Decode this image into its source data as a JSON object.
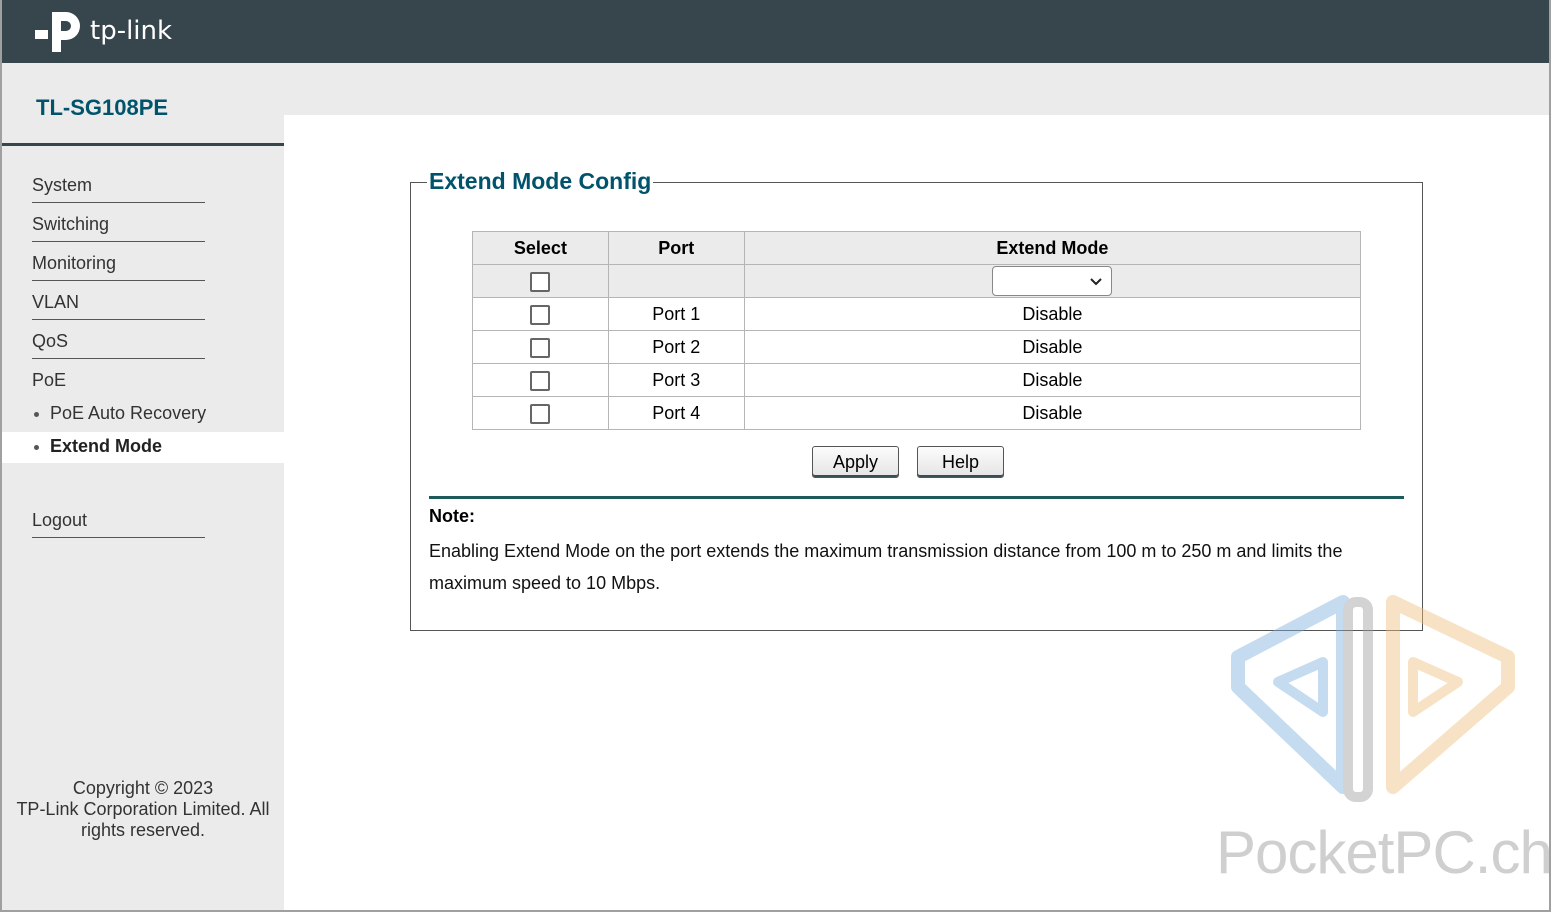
{
  "header": {
    "logo_text": "tp-link"
  },
  "sidebar": {
    "model": "TL-SG108PE",
    "menu": [
      {
        "label": "System"
      },
      {
        "label": "Switching"
      },
      {
        "label": "Monitoring"
      },
      {
        "label": "VLAN"
      },
      {
        "label": "QoS"
      },
      {
        "label": "PoE"
      }
    ],
    "sub_items": [
      {
        "label": "PoE Auto Recovery",
        "active": false
      },
      {
        "label": "Extend Mode",
        "active": true
      }
    ],
    "logout": "Logout",
    "copyright_line1": "Copyright © 2023",
    "copyright_line2": "TP-Link Corporation Limited. All",
    "copyright_line3": "rights reserved."
  },
  "main": {
    "title": "Extend Mode Config",
    "columns": [
      "Select",
      "Port",
      "Extend Mode"
    ],
    "control_row": {
      "port": "",
      "extend_mode_value": ""
    },
    "rows": [
      {
        "port": "Port 1",
        "extend_mode": "Disable",
        "selected": false
      },
      {
        "port": "Port 2",
        "extend_mode": "Disable",
        "selected": false
      },
      {
        "port": "Port 3",
        "extend_mode": "Disable",
        "selected": false
      },
      {
        "port": "Port 4",
        "extend_mode": "Disable",
        "selected": false
      }
    ],
    "buttons": {
      "apply": "Apply",
      "help": "Help"
    },
    "note": {
      "title": "Note:",
      "text": "Enabling Extend Mode on the port extends the maximum transmission distance from 100 m to 250 m and limits the maximum speed to 10 Mbps."
    }
  },
  "watermark": {
    "text": "PocketPC.ch"
  },
  "colors": {
    "topbar": "#37454d",
    "sidebar_bg": "#ebebeb",
    "accent": "#00536b"
  }
}
